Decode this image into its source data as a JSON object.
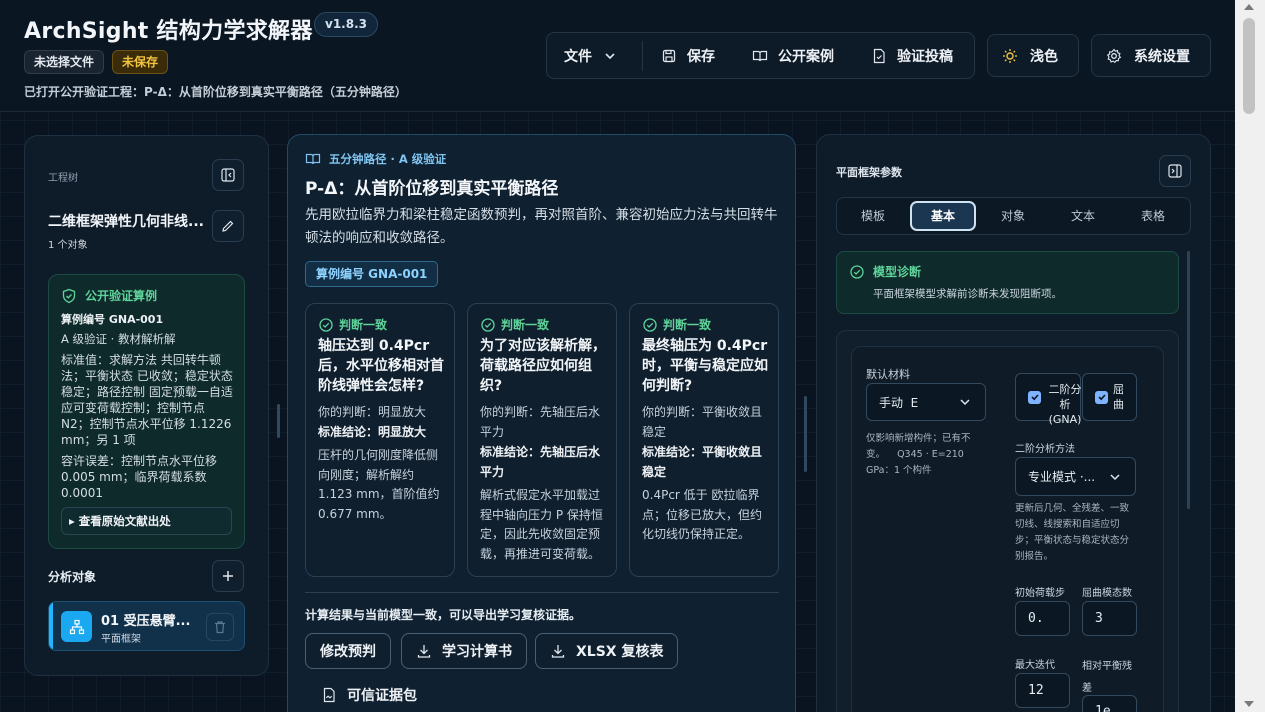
{
  "header": {
    "title": "ArchSight 结构力学求解器",
    "version": "v1.8.3",
    "file_chip": "未选择文件",
    "unsaved_chip": "未保存",
    "subline": "已打开公开验证工程：P-Δ：从首阶位移到真实平衡路径（五分钟路径）",
    "toolbar": {
      "file": "文件",
      "save": "保存",
      "cases": "公开案例",
      "submit": "验证投稿"
    },
    "theme": "浅色",
    "settings": "系统设置"
  },
  "left": {
    "tree_label": "工程树",
    "project_name": "二维框架弹性几何非线...",
    "project_count": "1 个对象",
    "verify": {
      "title": "公开验证算例",
      "case_id": "算例编号 GNA-001",
      "level": "A 级验证 · 教材解析解",
      "standard": "标准值：求解方法 共回转牛顿法；平衡状态 已收敛；稳定状态 稳定；路径控制 固定预载一自适应可变荷载控制；控制节点 N2；控制节点水平位移 1.1226 mm；另 1 项",
      "tolerance": "容许误差：控制节点水平位移 0.005 mm；临界荷载系数 0.0001",
      "source": "▸ 查看原始文献出处"
    },
    "objects_label": "分析对象",
    "object": {
      "name": "01 受压悬臂...",
      "type": "平面框架"
    }
  },
  "middle": {
    "eyebrow": "五分钟路径 · A 级验证",
    "title": "P-Δ：从首阶位移到真实平衡路径",
    "desc": "先用欧拉临界力和梁柱稳定函数预判，再对照首阶、兼容初始应力法与共回转牛顿法的响应和收敛路径。",
    "case_badge": "算例编号 GNA-001",
    "cards": [
      {
        "tag": "判断一致",
        "question": "轴压达到 0.4Pcr 后，水平位移相对首阶线弹性会怎样?",
        "judgement": "你的判断：明显放大",
        "conclusion": "标准结论：明显放大",
        "explain": "压杆的几何刚度降低侧向刚度；解析解约 1.123 mm，首阶值约 0.677 mm。"
      },
      {
        "tag": "判断一致",
        "question": "为了对应该解析解，荷载路径应如何组织?",
        "judgement": "你的判断：先轴压后水平力",
        "conclusion": "标准结论：先轴压后水平力",
        "explain": "解析式假定水平加载过程中轴向压力 P 保持恒定，因此先收敛固定预载，再推进可变荷载。"
      },
      {
        "tag": "判断一致",
        "question": "最终轴压为 0.4Pcr 时，平衡与稳定应如何判断?",
        "judgement": "你的判断：平衡收敛且稳定",
        "conclusion": "标准结论：平衡收敛且稳定",
        "explain": "0.4Pcr 低于 欧拉临界点；位移已放大，但约化切线仍保持正定。"
      }
    ],
    "result_note": "计算结果与当前模型一致，可以导出学习复核证据。",
    "buttons": {
      "modify": "修改预判",
      "report": "学习计算书",
      "xlsx": "XLSX 复核表"
    },
    "evidence": "可信证据包"
  },
  "right": {
    "title": "平面框架参数",
    "tabs": [
      "模板",
      "基本",
      "对象",
      "文本",
      "表格"
    ],
    "active_tab": "基本",
    "diag_title": "模型诊断",
    "diag_text": "平面框架模型求解前诊断未发现阻断项。",
    "material_label": "默认材料",
    "material_value": "手动  E",
    "material_note": "仅影响新增构件；已有不变。    Q345 · E=210 GPa：1 个构件",
    "gna_label": "二阶分析 (GNA)",
    "buckling_label": "屈曲",
    "method_label": "二阶分析方法",
    "method_value": "专业模式 ·...",
    "method_note": "更新后几何、全残差、一致切线、线搜索和自适应切步；平衡状态与稳定状态分别报告。",
    "init_step_label": "初始荷载步",
    "init_step_value": "0.",
    "modes_label": "屈曲模态数",
    "modes_value": "3",
    "max_iter_label": "最大迭代",
    "max_iter_value": "12",
    "residual_label": "相对平衡残差",
    "residual_value": "1e"
  }
}
